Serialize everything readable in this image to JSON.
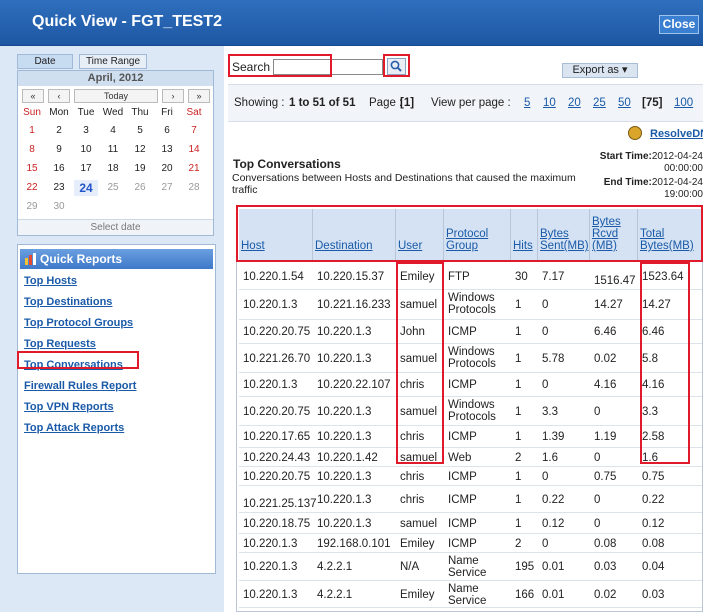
{
  "window": {
    "title": "Quick View - FGT_TEST2",
    "close_label": "Close"
  },
  "calendar": {
    "tabs": [
      "Date",
      "Time Range"
    ],
    "month": "April, 2012",
    "nav": {
      "prev_year": "«",
      "prev_month": "‹",
      "today": "Today",
      "next_month": "›",
      "next_year": "»"
    },
    "weekdays": [
      "Sun",
      "Mon",
      "Tue",
      "Wed",
      "Thu",
      "Fri",
      "Sat"
    ],
    "weeks": [
      [
        "1",
        "2",
        "3",
        "4",
        "5",
        "6",
        "7"
      ],
      [
        "8",
        "9",
        "10",
        "11",
        "12",
        "13",
        "14"
      ],
      [
        "15",
        "16",
        "17",
        "18",
        "19",
        "20",
        "21"
      ],
      [
        "22",
        "23",
        "24",
        "25",
        "26",
        "27",
        "28"
      ],
      [
        "29",
        "30",
        "",
        "",
        "",
        "",
        ""
      ]
    ],
    "selected_day": "24",
    "footer": "Select date"
  },
  "quick_reports": {
    "header": "Quick Reports",
    "items": [
      "Top Hosts",
      "Top Destinations",
      "Top Protocol Groups",
      "Top Requests",
      "Top Conversations",
      "Firewall Rules Report",
      "Top VPN Reports",
      "Top Attack Reports"
    ],
    "highlighted": "Top Conversations"
  },
  "search": {
    "label": "Search",
    "value": ""
  },
  "export": {
    "label": "Export as ▾"
  },
  "pager": {
    "showing_prefix": "Showing : ",
    "range": "1 to 51 of 51",
    "page_label": "Page :",
    "page_current": "[1]",
    "view_label": "View per page :",
    "options": [
      "5",
      "10",
      "20",
      "25",
      "50"
    ],
    "current": "[75]",
    "option_last": "100"
  },
  "resolve_dns": "ResolveDNS",
  "report": {
    "title": "Top Conversations",
    "description": "Conversations between Hosts and Destinations that caused the maximum traffic",
    "start_label": "Start Time:",
    "start_date": "2012-04-24",
    "start_time": "00:00:00",
    "end_label": "End Time:",
    "end_date": "2012-04-24",
    "end_time": "19:00:00"
  },
  "table": {
    "headers": [
      "Host",
      "Destination",
      "User",
      "Protocol Group",
      "Hits",
      "Bytes Sent(MB)",
      "Bytes Rcvd (MB)",
      "Total Bytes(MB)"
    ],
    "rows": [
      [
        "10.220.1.54",
        "10.220.15.37",
        "Emiley",
        "FTP",
        "30",
        "7.17",
        "1516.47",
        "1523.64"
      ],
      [
        "10.220.1.3",
        "10.221.16.233",
        "samuel",
        "Windows Protocols",
        "1",
        "0",
        "14.27",
        "14.27"
      ],
      [
        "10.220.20.75",
        "10.220.1.3",
        "John",
        "ICMP",
        "1",
        "0",
        "6.46",
        "6.46"
      ],
      [
        "10.221.26.70",
        "10.220.1.3",
        "samuel",
        "Windows Protocols",
        "1",
        "5.78",
        "0.02",
        "5.8"
      ],
      [
        "10.220.1.3",
        "10.220.22.107",
        "chris",
        "ICMP",
        "1",
        "0",
        "4.16",
        "4.16"
      ],
      [
        "10.220.20.75",
        "10.220.1.3",
        "samuel",
        "Windows Protocols",
        "1",
        "3.3",
        "0",
        "3.3"
      ],
      [
        "10.220.17.65",
        "10.220.1.3",
        "chris",
        "ICMP",
        "1",
        "1.39",
        "1.19",
        "2.58"
      ],
      [
        "10.220.24.43",
        "10.220.1.42",
        "samuel",
        "Web",
        "2",
        "1.6",
        "0",
        "1.6"
      ],
      [
        "10.220.20.75",
        "10.220.1.3",
        "chris",
        "ICMP",
        "1",
        "0",
        "0.75",
        "0.75"
      ],
      [
        "10.221.25.137",
        "10.220.1.3",
        "chris",
        "ICMP",
        "1",
        "0.22",
        "0",
        "0.22"
      ],
      [
        "10.220.18.75",
        "10.220.1.3",
        "samuel",
        "ICMP",
        "1",
        "0.12",
        "0",
        "0.12"
      ],
      [
        "10.220.1.3",
        "192.168.0.101",
        "Emiley",
        "ICMP",
        "2",
        "0",
        "0.08",
        "0.08"
      ],
      [
        "10.220.1.3",
        "4.2.2.1",
        "N/A",
        "Name Service",
        "195",
        "0.01",
        "0.03",
        "0.04"
      ],
      [
        "10.220.1.3",
        "4.2.2.1",
        "Emiley",
        "Name Service",
        "166",
        "0.01",
        "0.02",
        "0.03"
      ]
    ]
  },
  "colors": {
    "title_bar": "#1d57a3",
    "highlight_box": "#e0192b",
    "link": "#1a5aa8",
    "header_bg": "#d4e2f3"
  }
}
